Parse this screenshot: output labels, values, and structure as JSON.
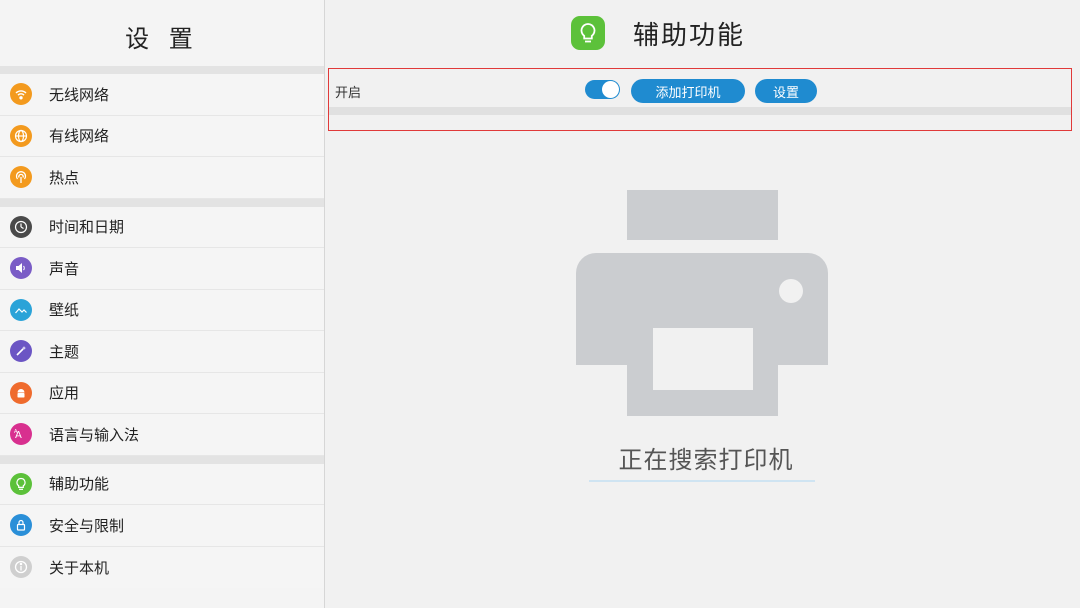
{
  "sidebar": {
    "title": "设 置",
    "groups": [
      [
        {
          "label": "无线网络",
          "icon": "wifi-icon",
          "color": "#f39a1e"
        },
        {
          "label": "有线网络",
          "icon": "globe-icon",
          "color": "#f39a1e"
        },
        {
          "label": "热点",
          "icon": "hotspot-icon",
          "color": "#f39a1e"
        }
      ],
      [
        {
          "label": "时间和日期",
          "icon": "clock-icon",
          "color": "#4a4a4a"
        },
        {
          "label": "声音",
          "icon": "speaker-icon",
          "color": "#7a5cc6"
        },
        {
          "label": "壁纸",
          "icon": "wallpaper-icon",
          "color": "#2aa3d8"
        },
        {
          "label": "主题",
          "icon": "theme-wand-icon",
          "color": "#6b55c4"
        },
        {
          "label": "应用",
          "icon": "android-icon",
          "color": "#ef6b2d"
        },
        {
          "label": "语言与输入法",
          "icon": "language-icon",
          "color": "#d8308f"
        }
      ],
      [
        {
          "label": "辅助功能",
          "icon": "bulb-icon",
          "color": "#5cc13a"
        },
        {
          "label": "安全与限制",
          "icon": "lock-icon",
          "color": "#2a8fd8"
        },
        {
          "label": "关于本机",
          "icon": "info-icon",
          "color": "#cfcfcf"
        }
      ]
    ]
  },
  "main": {
    "title": "辅助功能",
    "header_icon": "bulb-icon",
    "toolbar": {
      "enable_label": "开启",
      "toggle_on": true,
      "add_printer_label": "添加打印机",
      "settings_label": "设置"
    },
    "status_text": "正在搜索打印机"
  },
  "colors": {
    "accent": "#1f8bd0",
    "highlight_border": "#e03a3a",
    "printer_gray": "#cbcdd0"
  }
}
